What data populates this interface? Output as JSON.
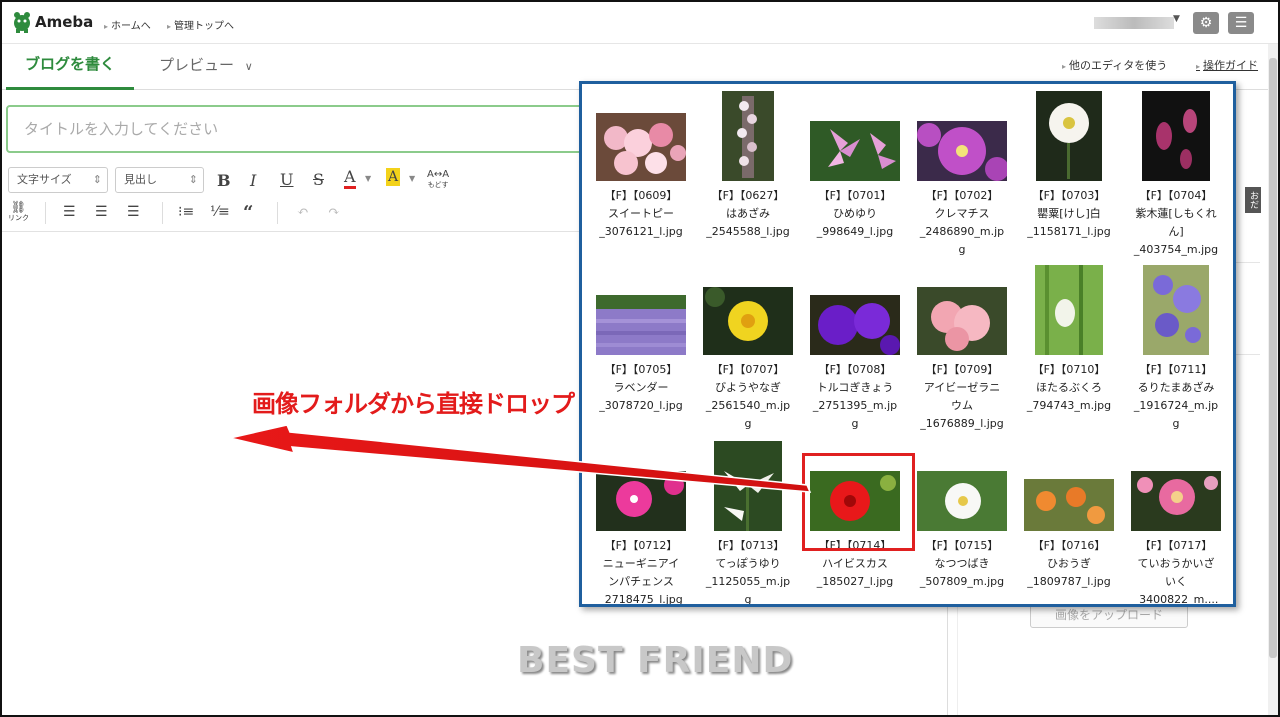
{
  "header": {
    "logo_text": "Ameba",
    "links": [
      "ホームへ",
      "管理トップへ"
    ],
    "settings_icon": "gear-icon",
    "menu_icon": "hamburger-icon"
  },
  "tabs": {
    "write": "ブログを書く",
    "preview": "プレビュー",
    "other_editor": "他のエディタを使う",
    "guide": "操作ガイド"
  },
  "editor": {
    "title_placeholder": "タイトルを入力してください",
    "font_size_select": "文字サイズ",
    "heading_select": "見出し",
    "link_label": "リンク",
    "reset_label": "もどす"
  },
  "side": {
    "tab_label": "おだ",
    "upload_button": "画像をアップロード"
  },
  "watermark": "BEST FRIEND",
  "annotation": "画像フォルダから直接ドロップ",
  "folder": {
    "files": [
      {
        "line1": "【F】【0609】",
        "line2": "スイートピー",
        "line3": "_3076121_l.jpg"
      },
      {
        "line1": "【F】【0627】",
        "line2": "はあざみ",
        "line3": "_2545588_l.jpg"
      },
      {
        "line1": "【F】【0701】",
        "line2": "ひめゆり",
        "line3": "_998649_l.jpg"
      },
      {
        "line1": "【F】【0702】",
        "line2": "クレマチス",
        "line3": "_2486890_m.jp",
        "line4": "g"
      },
      {
        "line1": "【F】【0703】",
        "line2": "罌粟[けし]白",
        "line3": "_1158171_l.jpg"
      },
      {
        "line1": "【F】【0704】",
        "line2": "紫木蓮[しもくれ",
        "line3": "ん]",
        "line4": "_403754_m.jpg"
      },
      {
        "line1": "【F】【0705】",
        "line2": "ラベンダー",
        "line3": "_3078720_l.jpg"
      },
      {
        "line1": "【F】【0707】",
        "line2": "びようやなぎ",
        "line3": "_2561540_m.jp",
        "line4": "g"
      },
      {
        "line1": "【F】【0708】",
        "line2": "トルコぎきょう",
        "line3": "_2751395_m.jp",
        "line4": "g"
      },
      {
        "line1": "【F】【0709】",
        "line2": "アイビーゼラニ",
        "line3": "ウム",
        "line4": "_1676889_l.jpg"
      },
      {
        "line1": "【F】【0710】",
        "line2": "ほたるぶくろ",
        "line3": "_794743_m.jpg"
      },
      {
        "line1": "【F】【0711】",
        "line2": "るりたまあざみ",
        "line3": "_1916724_m.jp",
        "line4": "g"
      },
      {
        "line1": "【F】【0712】",
        "line2": "ニューギニアイ",
        "line3": "ンパチェンス",
        "line4": "_2718475_l.jpg"
      },
      {
        "line1": "【F】【0713】",
        "line2": "てっぽうゆり",
        "line3": "_1125055_m.jp",
        "line4": "g"
      },
      {
        "line1": "【F】【0714】",
        "line2": "ハイビスカス",
        "line3": "_185027_l.jpg"
      },
      {
        "line1": "【F】【0715】",
        "line2": "なつつばき",
        "line3": "_507809_m.jpg"
      },
      {
        "line1": "【F】【0716】",
        "line2": "ひおうぎ",
        "line3": "_1809787_l.jpg"
      },
      {
        "line1": "【F】【0717】",
        "line2": "ていおうかいざ",
        "line3": "いく",
        "line4": "_3400822_m...."
      }
    ]
  }
}
